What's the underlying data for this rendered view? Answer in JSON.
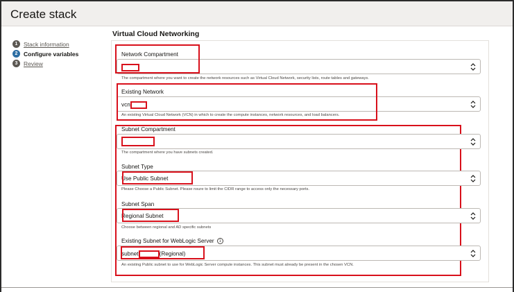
{
  "page": {
    "title": "Create stack"
  },
  "steps": [
    {
      "number": "1",
      "label": "Stack information",
      "state": "done"
    },
    {
      "number": "2",
      "label": "Configure variables",
      "state": "active"
    },
    {
      "number": "3",
      "label": "Review",
      "state": "done"
    }
  ],
  "section": {
    "title": "Virtual Cloud Networking"
  },
  "fields": {
    "network_compartment": {
      "label": "Network Compartment",
      "value": "",
      "help": "The compartment where you want to create the network resources such as Virtual Cloud Network, security lists, route tables and gateways."
    },
    "existing_network": {
      "label": "Existing Network",
      "value_prefix": "vcn",
      "help": "An existing Virtual Cloud Network (VCN) in which to create the compute instances, network resources, and load balancers."
    },
    "subnet_compartment": {
      "label": "Subnet Compartment",
      "value": "",
      "help": "The compartment where you have subnets created."
    },
    "subnet_type": {
      "label": "Subnet Type",
      "value": "Use Public Subnet",
      "help": "Please Choose a Public Subnet. Please nsure to limit the CIDR range to access only the necessary ports."
    },
    "subnet_span": {
      "label": "Subnet Span",
      "value": "Regional Subnet",
      "help": "Choose between regional and AD specific subnets"
    },
    "existing_subnet": {
      "label": "Existing Subnet for WebLogic Server",
      "value_prefix": "subnet",
      "value_suffix": "(Regional)",
      "help": "An existing Public subnet to use for WebLogic Server compute instances. This subnet must already be present in the chosen VCN."
    }
  },
  "icons": {
    "select_arrow": "chevron-up-down-icon",
    "info": "info-circle-icon"
  },
  "colors": {
    "highlight": "#d8101b",
    "active_step": "#2d6ea3",
    "header_bg": "#f1efed"
  }
}
